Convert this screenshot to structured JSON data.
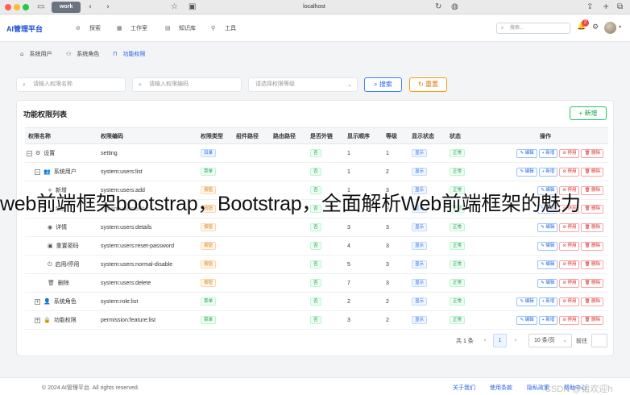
{
  "browser": {
    "tab_label": "work",
    "url": "localhost"
  },
  "header": {
    "brand": "AI管理平台",
    "nav": [
      "探索",
      "工作室",
      "知识库",
      "工具"
    ],
    "search_placeholder": "搜索...",
    "notification_count": "2"
  },
  "subtabs": [
    "系统用户",
    "系统角色",
    "功能权限"
  ],
  "filters": {
    "name_placeholder": "请输入权限名称",
    "code_placeholder": "请输入权限编码",
    "level_placeholder": "请选择权限等级",
    "search_label": "搜索",
    "reset_label": "重置"
  },
  "card": {
    "title": "功能权限列表",
    "add_label": "+ 新增"
  },
  "table": {
    "columns": [
      "权限名称",
      "权限编码",
      "权限类型",
      "组件路径",
      "路由路径",
      "是否外链",
      "显示顺序",
      "等级",
      "显示状态",
      "状态",
      "操作"
    ],
    "rows": [
      {
        "tree": "−",
        "icon": "⚙",
        "name": "设置",
        "code": "setting",
        "type": "目录",
        "type_color": "blue",
        "external": "否",
        "order": "1",
        "level": "1",
        "display": "显示",
        "status": "正常",
        "actions": [
          "✎ 编辑",
          "+ 新增",
          "⊘ 停用",
          "🗑 删除"
        ]
      },
      {
        "tree": "−",
        "icon": "👥",
        "name": "系统用户",
        "code": "system:users:list",
        "type": "菜单",
        "type_color": "green",
        "external": "否",
        "order": "1",
        "level": "2",
        "display": "显示",
        "status": "正常",
        "actions": [
          "✎ 编辑",
          "+ 新增",
          "⊘ 停用",
          "🗑 删除"
        ]
      },
      {
        "tree": "",
        "icon": "+",
        "name": "新增",
        "code": "system:users:add",
        "type": "按钮",
        "type_color": "orange",
        "external": "否",
        "order": "1",
        "level": "3",
        "display": "显示",
        "status": "正常",
        "actions": [
          "✎ 编辑",
          "⊘ 停用",
          "🗑 删除"
        ]
      },
      {
        "tree": "",
        "icon": "✎",
        "name": "编辑",
        "code": "system:users:edit",
        "type": "按钮",
        "type_color": "orange",
        "external": "否",
        "order": "2",
        "level": "3",
        "display": "显示",
        "status": "正常",
        "actions": [
          "✎ 编辑",
          "⊘ 停用",
          "🗑 删除"
        ]
      },
      {
        "tree": "",
        "icon": "◉",
        "name": "详情",
        "code": "system:users:details",
        "type": "按钮",
        "type_color": "orange",
        "external": "否",
        "order": "3",
        "level": "3",
        "display": "显示",
        "status": "正常",
        "actions": [
          "✎ 编辑",
          "⊘ 停用",
          "🗑 删除"
        ]
      },
      {
        "tree": "",
        "icon": "▣",
        "name": "重置密码",
        "code": "system:users:reset-password",
        "type": "按钮",
        "type_color": "orange",
        "external": "否",
        "order": "4",
        "level": "3",
        "display": "显示",
        "status": "正常",
        "actions": [
          "✎ 编辑",
          "⊘ 停用",
          "🗑 删除"
        ]
      },
      {
        "tree": "",
        "icon": "⏻",
        "name": "启用/停用",
        "code": "system:users:normal-disable",
        "type": "按钮",
        "type_color": "orange",
        "external": "否",
        "order": "5",
        "level": "3",
        "display": "显示",
        "status": "正常",
        "actions": [
          "✎ 编辑",
          "⊘ 停用",
          "🗑 删除"
        ]
      },
      {
        "tree": "",
        "icon": "🗑",
        "name": "删除",
        "code": "system:users:delete",
        "type": "按钮",
        "type_color": "orange",
        "external": "否",
        "order": "7",
        "level": "3",
        "display": "显示",
        "status": "正常",
        "actions": [
          "✎ 编辑",
          "⊘ 停用",
          "🗑 删除"
        ]
      },
      {
        "tree": "+",
        "icon": "👤",
        "name": "系统角色",
        "code": "system:role:list",
        "type": "菜单",
        "type_color": "green",
        "external": "否",
        "order": "2",
        "level": "2",
        "display": "显示",
        "status": "正常",
        "actions": [
          "✎ 编辑",
          "+ 新增",
          "⊘ 停用",
          "🗑 删除"
        ]
      },
      {
        "tree": "+",
        "icon": "🔒",
        "name": "功能权限",
        "code": "permission:feature:list",
        "type": "菜单",
        "type_color": "green",
        "external": "否",
        "order": "3",
        "level": "2",
        "display": "显示",
        "status": "正常",
        "actions": [
          "✎ 编辑",
          "+ 新增",
          "⊘ 停用",
          "🗑 删除"
        ]
      }
    ]
  },
  "pagination": {
    "total": "共 1 条",
    "current": "1",
    "page_size": "10 条/页",
    "jump_label": "前往"
  },
  "footer": {
    "copyright": "© 2024 AI管理平台. All rights reserved.",
    "links": [
      "关于我们",
      "使用条款",
      "隐私政策",
      "帮助中心"
    ]
  },
  "overlay_title": "web前端框架bootstrap，Bootstrap，全面解析Web前端框架的魅力",
  "watermark": "CSDN @请欢迎h"
}
